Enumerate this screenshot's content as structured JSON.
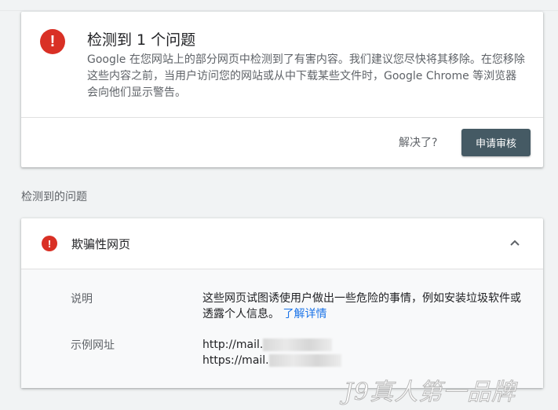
{
  "summary": {
    "title": "检测到 1 个问题",
    "description": "Google 在您网站上的部分网页中检测到了有害内容。我们建议您尽快将其移除。在您移除这些内容之前，当用户访问您的网站或从中下载某些文件时，Google Chrome 等浏览器会向他们显示警告。",
    "resolved_label": "解决了?",
    "review_button": "申请审核",
    "alert_glyph": "!"
  },
  "issues_section": {
    "label": "检测到的问题",
    "issue": {
      "title": "欺骗性网页",
      "alert_glyph": "!",
      "description_label": "说明",
      "description_text": "这些网页试图诱使用户做出一些危险的事情，例如安装垃圾软件或透露个人信息。",
      "learn_more": "了解详情",
      "examples_label": "示例网址",
      "example_urls": [
        "http://mail.",
        "https://mail."
      ]
    }
  },
  "watermark": "J9真人第一品牌",
  "colors": {
    "alert_red": "#d93025",
    "button_bg": "#455a64",
    "link_blue": "#1a73e8",
    "page_bg": "#f1f3f4"
  },
  "icons": {
    "alert": "error-icon",
    "collapse": "chevron-up-icon"
  }
}
